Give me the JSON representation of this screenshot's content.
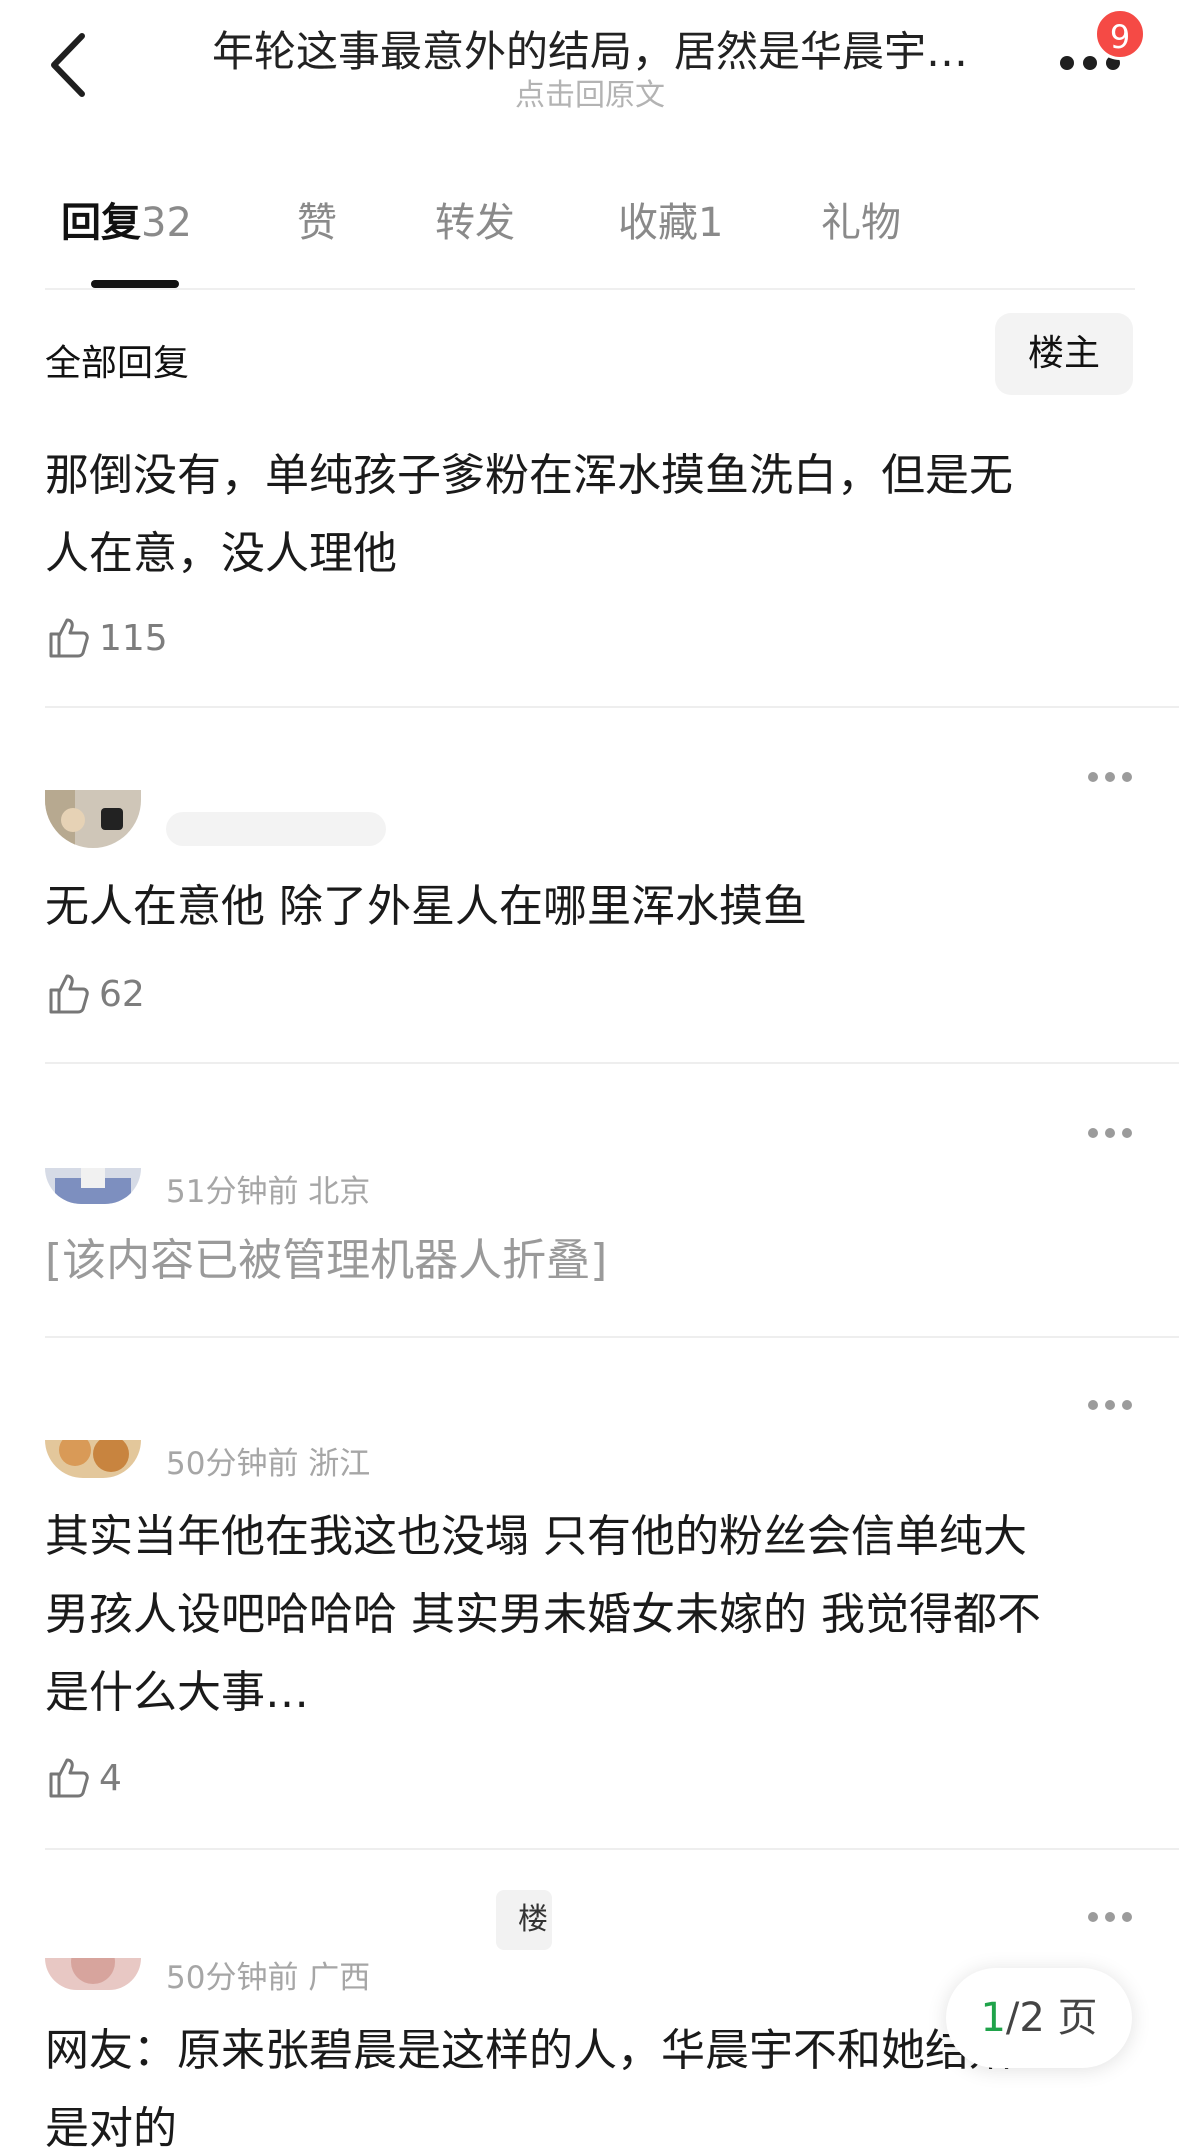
{
  "header": {
    "title": "年轮这事最意外的结局，居然是华晨宇…",
    "subtitle": "点击回原文",
    "badge_count": "9"
  },
  "tabs": [
    {
      "label": "回复",
      "count": "32",
      "active": true
    },
    {
      "label": "赞",
      "count": "",
      "active": false
    },
    {
      "label": "转发",
      "count": "",
      "active": false
    },
    {
      "label": "收藏",
      "count": "1",
      "active": false
    },
    {
      "label": "礼物",
      "count": "",
      "active": false
    }
  ],
  "section": {
    "title": "全部回复",
    "owner_filter_label": "楼主"
  },
  "main_post": {
    "lines": [
      "那倒没有，单纯孩子爹粉在浑水摸鱼洗白，但是无",
      "人在意，没人理他"
    ],
    "likes": "115"
  },
  "replies": [
    {
      "meta": "",
      "lines": [
        "无人在意他 除了外星人在哪里浑水摸鱼"
      ],
      "likes": "62"
    },
    {
      "meta": "51分钟前 北京",
      "lines": [
        "[该内容已被管理机器人折叠]"
      ],
      "folded": true
    },
    {
      "meta": "50分钟前 浙江",
      "lines": [
        "其实当年他在我这也没塌 只有他的粉丝会信单纯大",
        "男孩人设吧哈哈哈 其实男未婚女未嫁的 我觉得都不",
        "是什么大事…"
      ],
      "likes": "4"
    },
    {
      "meta": "50分钟前 广西",
      "owner_tag": "楼主",
      "lines": [
        "网友：原来张碧晨是这样的人，华晨宇不和她结婚",
        "是对的"
      ]
    }
  ],
  "pager": {
    "current": "1",
    "total_label": "/2 页"
  },
  "colors": {
    "badge": "#f54a45",
    "pager_current": "#1fa34a",
    "muted_text": "#a6a6a6"
  }
}
